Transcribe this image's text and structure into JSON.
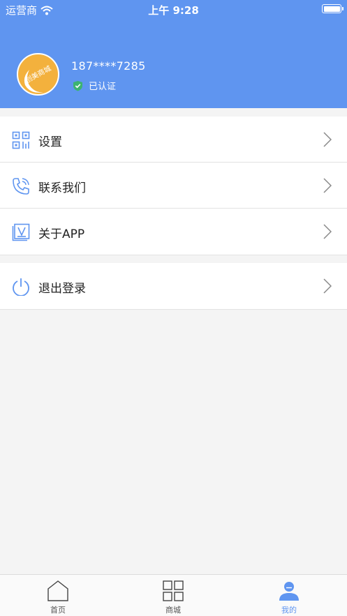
{
  "status_bar": {
    "carrier": "运营商",
    "time": "上午 9:28"
  },
  "profile": {
    "avatar_text": "创美商城",
    "phone": "187****7285",
    "verified_label": "已认证"
  },
  "menu_group_1": [
    {
      "label": "设置",
      "icon": "qrcode-icon"
    },
    {
      "label": "联系我们",
      "icon": "phone-icon"
    },
    {
      "label": "关于APP",
      "icon": "about-icon"
    }
  ],
  "menu_group_2": [
    {
      "label": "退出登录",
      "icon": "power-icon"
    }
  ],
  "tabbar": {
    "items": [
      {
        "label": "首页",
        "icon": "home-icon"
      },
      {
        "label": "商城",
        "icon": "grid-icon"
      },
      {
        "label": "我的",
        "icon": "user-icon"
      }
    ],
    "active": "我的"
  },
  "colors": {
    "primary": "#5f95f0",
    "avatar": "#f3b13d",
    "verified": "#3cb371"
  }
}
